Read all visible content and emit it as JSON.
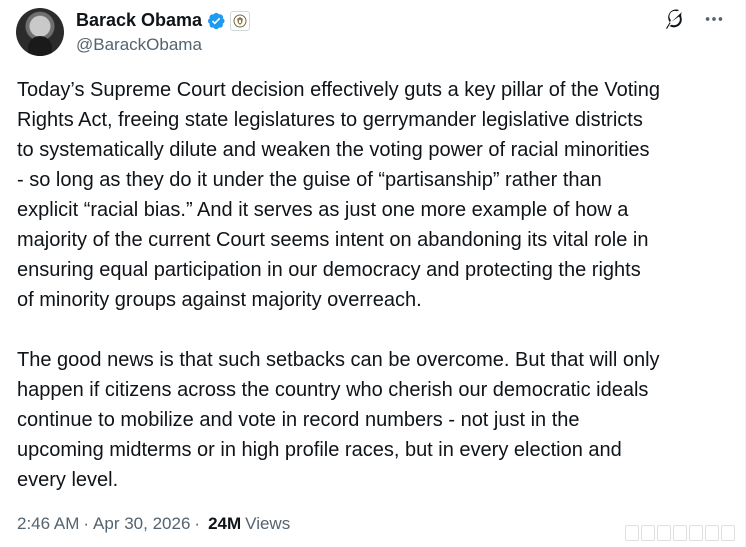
{
  "author": {
    "display_name": "Barack Obama",
    "handle": "@BarackObama",
    "verified_icon": "blue-check-badge",
    "affiliate_icon": "government-seal"
  },
  "tweet": {
    "paragraph_1": "Today’s Supreme Court decision effectively guts a key pillar of the Voting\nRights Act, freeing state legislatures to gerrymander legislative districts\nto systematically dilute and weaken the voting power of racial minorities\n- so long as they do it under the guise of “partisanship” rather than\nexplicit “racial bias.” And it serves as just one more example of how a\nmajority of the current Court seems intent on abandoning its vital role in\nensuring equal participation in our democracy and protecting the rights\nof minority groups against majority overreach.",
    "paragraph_2": "The good news is that such setbacks can be overcome. But that will only\nhappen if citizens across the country who cherish our democratic ideals\ncontinue to mobilize and vote in record numbers - not just in the\nupcoming midterms or in high profile races, but in every election and\nevery level."
  },
  "meta": {
    "time": "2:46 AM",
    "separator": "·",
    "date": "Apr 30, 2026",
    "views_count": "24M",
    "views_label": "Views"
  },
  "actions": {
    "grok_icon": "grok-icon",
    "more_icon": "more-icon"
  },
  "colors": {
    "text": "#0f1419",
    "secondary": "#536471",
    "verified": "#1d9bf0"
  }
}
